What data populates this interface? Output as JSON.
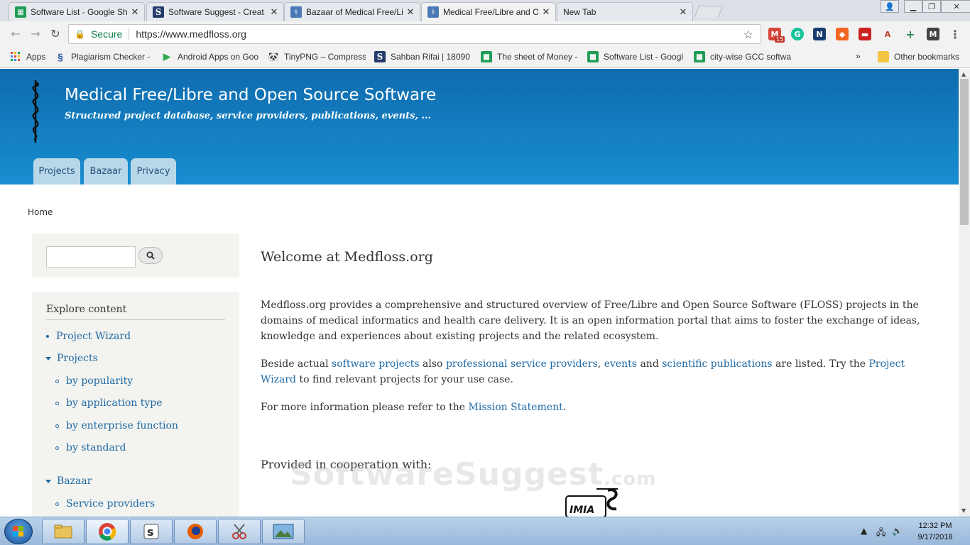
{
  "browser": {
    "tabs": [
      {
        "title": "Software List - Google Sh",
        "icon": "sheet-icon"
      },
      {
        "title": "Software Suggest - Creat",
        "icon": "softwaresuggest-icon"
      },
      {
        "title": "Bazaar of Medical Free/Li",
        "icon": "medfloss-icon"
      },
      {
        "title": "Medical Free/Libre and O",
        "icon": "medfloss-icon"
      },
      {
        "title": "New Tab",
        "icon": ""
      }
    ],
    "close_glyph": "✕",
    "secure_label": "Secure",
    "url": "https://www.medfloss.org",
    "bookmarks": [
      {
        "label": "Apps",
        "icon": "apps-grid-icon"
      },
      {
        "label": "Plagiarism Checker - ",
        "icon": "plagiarism-icon"
      },
      {
        "label": "Android Apps on Goo",
        "icon": "play-store-icon"
      },
      {
        "label": "TinyPNG – Compress",
        "icon": "panda-icon"
      },
      {
        "label": "Sahban Rifai | 18090",
        "icon": "softwaresuggest-icon"
      },
      {
        "label": "The sheet of Money -",
        "icon": "sheet-icon"
      },
      {
        "label": "Software List - Googl",
        "icon": "sheet-icon"
      },
      {
        "label": "city-wise GCC softwa",
        "icon": "sheet-icon"
      }
    ],
    "more_bookmarks": "»",
    "other_bookmarks": "Other bookmarks",
    "gmail_badge": "15"
  },
  "site": {
    "title": "Medical Free/Libre and Open Source Software",
    "slogan": "Structured project database, service providers, publications, events, ...",
    "nav": [
      "Projects",
      "Bazaar",
      "Privacy"
    ]
  },
  "breadcrumb": "Home",
  "sidebar": {
    "explore_title": "Explore content",
    "items": [
      {
        "label": "Project Wizard",
        "level": 0,
        "marker": "bullet"
      },
      {
        "label": "Projects",
        "level": 0,
        "marker": "triangle"
      },
      {
        "label": "by popularity",
        "level": 1,
        "marker": "circle"
      },
      {
        "label": "by application type",
        "level": 1,
        "marker": "circle"
      },
      {
        "label": "by enterprise function",
        "level": 1,
        "marker": "circle"
      },
      {
        "label": "by standard",
        "level": 1,
        "marker": "circle"
      },
      {
        "label": "Bazaar",
        "level": 0,
        "marker": "triangle"
      },
      {
        "label": "Service providers",
        "level": 1,
        "marker": "circle"
      }
    ]
  },
  "content": {
    "heading": "Welcome at Medfloss.org",
    "p1": "Medfloss.org provides a comprehensive and structured overview of Free/Libre and Open Source Software (FLOSS) projects in the domains of medical informatics and health care delivery. It is an open information portal that aims to foster the exchange of ideas, knowledge and experiences about existing projects and the related ecosystem.",
    "p2": {
      "t1": "Beside actual ",
      "l1": "software projects",
      "t2": " also ",
      "l2": "professional service providers",
      "t3": ", ",
      "l3": "events",
      "t4": " and ",
      "l4": "scientific publications",
      "t5": " are listed. Try the ",
      "l5": "Project Wizard",
      "t6": " to find relevant projects for your use case."
    },
    "p3": {
      "t1": "For more information please refer to the ",
      "l1": "Mission Statement",
      "t2": "."
    },
    "coop": "Provided in cooperation with:",
    "partner_logo_text": "IMIA"
  },
  "watermark": {
    "main": "SoftwareSuggest",
    "suffix": ".com"
  },
  "taskbar": {
    "apps": [
      "explorer-icon",
      "chrome-icon",
      "slack-icon",
      "firefox-icon",
      "snipping-tool-icon",
      "image-viewer-icon"
    ],
    "time": "12:32 PM",
    "date": "9/17/2018"
  },
  "colors": {
    "header_blue": "#1585c7",
    "nav_tab": "#b8d8ea",
    "link": "#1f6aa5",
    "sidebar_bg": "#f3f3ef"
  }
}
